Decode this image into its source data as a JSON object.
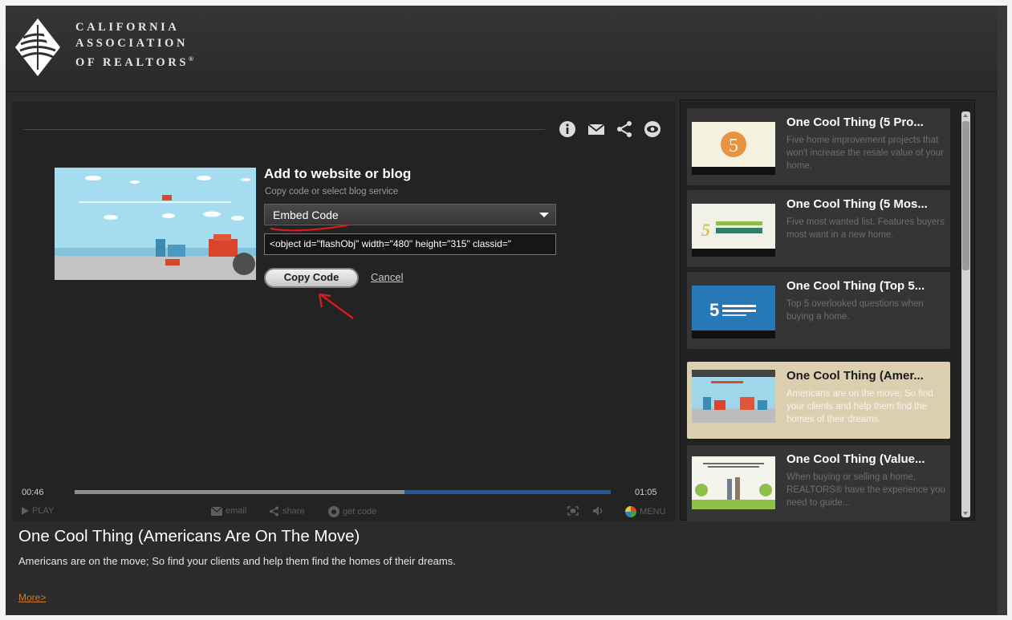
{
  "header": {
    "logo_icon": "car-diamond-logo-icon",
    "logo_line1": "CALIFORNIA",
    "logo_line2": "ASSOCIATION",
    "logo_line3": "OF REALTORS",
    "logo_mark": "®"
  },
  "player": {
    "toolbar_icons": [
      "info-icon",
      "email-icon",
      "share-icon",
      "eye-icon"
    ],
    "embed": {
      "title": "Add to website or blog",
      "subtitle": "Copy code or select blog service",
      "selected_option": "Embed Code",
      "code_value": "<object id=\"flashObj\" width=\"480\" height=\"315\" classid=\"",
      "copy_label": "Copy Code",
      "cancel_label": "Cancel"
    },
    "time_current": "00:46",
    "time_total": "01:05",
    "progress": 0.615,
    "controls": {
      "play_label": "PLAY",
      "email_label": "email",
      "share_label": "share",
      "getcode_label": "get code",
      "menu_label": "MENU"
    },
    "accent_color": "#1d5b98"
  },
  "playlist": {
    "items": [
      {
        "title": "One Cool Thing (5 Pro...",
        "desc": "Five home improvement projects that won't increase the resale value of your home."
      },
      {
        "title": "One Cool Thing (5 Mos...",
        "desc": "Five most wanted list. Features buyers most want in a new home."
      },
      {
        "title": "One Cool Thing (Top 5...",
        "desc": "Top 5 overlooked questions when buying a home."
      },
      {
        "title": "One Cool Thing (Amer...",
        "desc": "Americans are on the move; So find your clients and help them find the homes of their dreams."
      },
      {
        "title": "One Cool Thing (Value...",
        "desc": "When buying or selling a home, REALTORS® have the experience you need to guide..."
      }
    ],
    "active_index": 3,
    "active_color": "#dbcfb0"
  },
  "video": {
    "title": "One Cool Thing (Americans Are On The Move)",
    "description": "Americans are on the move; So find your clients and help them find the homes of their dreams.",
    "more_label": "More>"
  }
}
